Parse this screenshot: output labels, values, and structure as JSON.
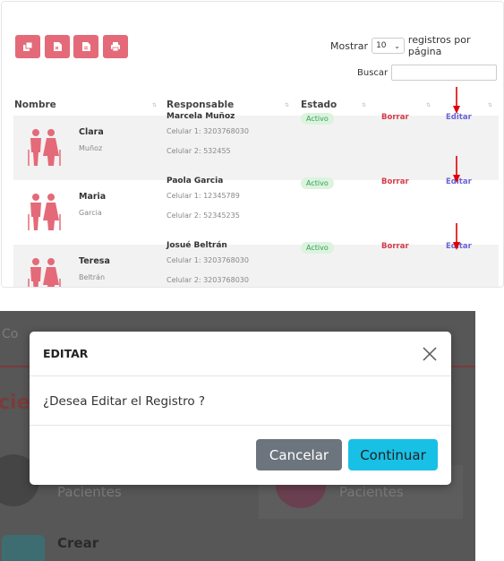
{
  "toolbar": {
    "buttons": [
      {
        "icon": "copy-icon"
      },
      {
        "icon": "excel-icon"
      },
      {
        "icon": "pdf-icon"
      },
      {
        "icon": "print-icon"
      }
    ]
  },
  "show": {
    "prefix": "Mostrar",
    "value": "10",
    "suffix": "registros por página"
  },
  "search": {
    "label": "Buscar",
    "value": ""
  },
  "table": {
    "headers": [
      "Nombre",
      "Responsable",
      "Estado"
    ],
    "rows": [
      {
        "first": "Clara",
        "last": "Muñoz",
        "responsable": "Marcela Muñoz",
        "cel1": "Celular 1: 3203768030",
        "cel2": "Celular 2: 532455",
        "estado": "Activo",
        "borrar": "Borrar",
        "editar": "Editar"
      },
      {
        "first": "Maria",
        "last": "Garcia",
        "responsable": "Paola Garcia",
        "cel1": "Celular 1: 12345789",
        "cel2": "Celular 2: 52345235",
        "estado": "Activo",
        "borrar": "Borrar",
        "editar": "Editar"
      },
      {
        "first": "Teresa",
        "last": "Beltrán",
        "responsable": "Josué Beltrán",
        "cel1": "Celular 1: 3203768030",
        "cel2": "Celular 2: 3203768030",
        "estado": "Activo",
        "borrar": "Borrar",
        "editar": "Editar"
      }
    ]
  },
  "background": {
    "header": "Co",
    "title": "cie",
    "card1": "Pacientes",
    "card2": "Pacientes",
    "create": "Crear"
  },
  "modal": {
    "title": "EDITAR",
    "message": "¿Desea Editar el Registro ?",
    "cancel": "Cancelar",
    "continue": "Continuar"
  },
  "colors": {
    "accent": "#e46a79",
    "borrar": "#d43b4a",
    "editar": "#6b63d6",
    "badge_bg": "#dbf3df",
    "badge_text": "#36a052",
    "cancel_bg": "#6c757d",
    "continue_bg": "#19c0e6",
    "arrow": "#e00000"
  }
}
